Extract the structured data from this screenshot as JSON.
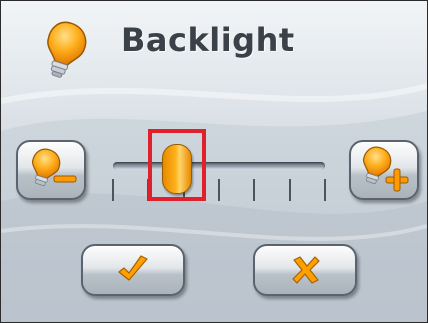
{
  "header": {
    "title": "Backlight",
    "icon": "lightbulb-icon"
  },
  "slider": {
    "name": "brightness",
    "level_fraction": 0.3,
    "tick_count": 7
  },
  "buttons": {
    "decrease_icon": "bulb-minus-icon",
    "increase_icon": "bulb-plus-icon",
    "ok_icon": "checkmark-icon",
    "cancel_icon": "x-icon"
  },
  "colors": {
    "accent_orange": "#ffa000",
    "highlight_red": "#e0202a",
    "title_text": "#3a4148"
  }
}
